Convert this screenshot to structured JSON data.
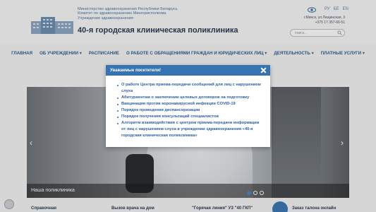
{
  "header": {
    "ministry_lines": [
      "Министерство здравоохранения Республики Беларусь",
      "Комитет по здравоохранению Мингорисполкома",
      "Учреждение здравоохранения"
    ],
    "clinic_name": "40-я городская клиническая поликлиника",
    "langs": [
      "РУ",
      "БЕ",
      "EN"
    ],
    "address_line1": "г.Минск, ул.Лещинская, 3",
    "address_line2": "+375 17 357-66-51",
    "search_placeholder": "поиск..."
  },
  "nav": {
    "items": [
      "ГЛАВНАЯ",
      "ОБ УЧРЕЖДЕНИИ ▾",
      "РАСПИСАНИЕ",
      "О РАБОТЕ С ОБРАЩЕНИЯМИ ГРАЖДАН И ЮРИДИЧЕСКИХ ЛИЦ ▾",
      "ДЕЯТЕЛЬНОСТЬ ▾",
      "ПЛАТНЫЕ УСЛУГИ ▾"
    ]
  },
  "slider": {
    "caption": "Наша поликлиника",
    "arrow_left": "‹",
    "arrow_right": "›"
  },
  "bottom": {
    "items": [
      "Справочная",
      "Вызов врача на дом",
      "\"Горячая линия\" УЗ \"40 ГКП\"",
      "Заказ талона онлайн"
    ]
  },
  "modal": {
    "title": "Уважаемые посетители!",
    "links": [
      "О работе Центра приема-передачи сообщений для лиц с нарушением слуха",
      "Абитуриентам о заключении целевых договоров на подготовку",
      "Вакцинация против коронавирусной инфекции COVID-19",
      "Порядок проведения диспансеризации",
      "Порядок получения консультаций специалистов",
      "Алгоритм взаимодействия с центром приема-передачи информации от лиц с нарушением слуха в учреждении здравоохранения «40-я городская клиническая поликлиника»"
    ]
  },
  "colors": {
    "modal_header": "#3574b0",
    "link": "#2c62a4",
    "nav": "#305f8f"
  }
}
